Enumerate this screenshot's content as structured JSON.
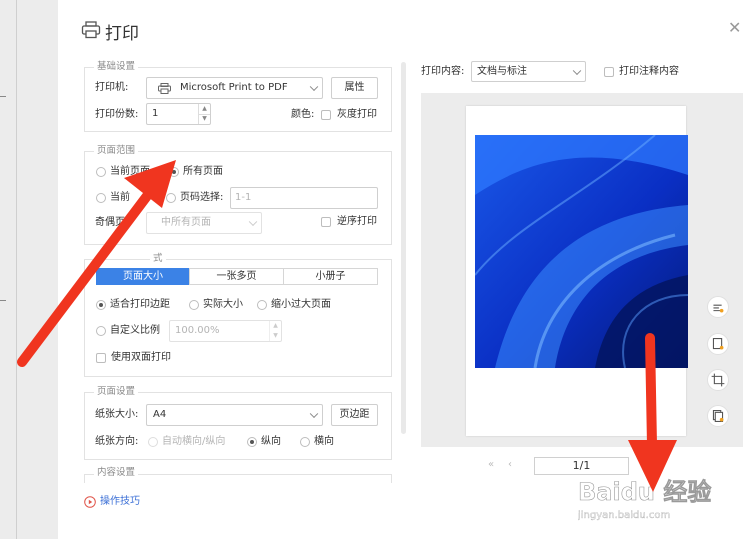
{
  "title": "打印",
  "basic": {
    "legend": "基础设置",
    "printer_label": "打印机:",
    "printer_value": "Microsoft Print to PDF",
    "properties_button": "属性",
    "copies_label": "打印份数:",
    "copies_value": "1",
    "color_label": "颜色:",
    "grayscale_label": "灰度打印"
  },
  "range": {
    "legend": "页面范围",
    "current_page": "当前页面",
    "all_pages": "所有页面",
    "selection_partial": "当前",
    "page_select_label": "页码选择:",
    "page_select_placeholder": "1-1",
    "odd_even_label_partial": "奇偶页",
    "odd_even_value_partial": "中所有页面",
    "reverse_label": "逆序打印"
  },
  "mode": {
    "legend_partial": "式",
    "tabs": [
      "页面大小",
      "一张多页",
      "小册子"
    ],
    "fit_margin": "适合打印边距",
    "actual_size": "实际大小",
    "shrink_large": "缩小过大页面",
    "custom_scale": "自定义比例",
    "custom_scale_value": "100.00%",
    "duplex": "使用双面打印"
  },
  "page_setup": {
    "legend": "页面设置",
    "paper_size_label": "纸张大小:",
    "paper_size_value": "A4",
    "margin_button": "页边距",
    "orientation_label": "纸张方向:",
    "auto_orientation": "自动横向/纵向",
    "portrait": "纵向",
    "landscape": "横向"
  },
  "content_settings_legend": "内容设置",
  "tips_link": "操作技巧",
  "print_content": {
    "label": "打印内容:",
    "value": "文档与标注",
    "annotations_label": "打印注释内容"
  },
  "pager": {
    "value": "1/1"
  },
  "watermark": {
    "brand": "Baidu 经验",
    "url": "jingyan.baidu.com"
  },
  "colors": {
    "accent": "#3b82e6",
    "arrow": "#f0351f"
  }
}
